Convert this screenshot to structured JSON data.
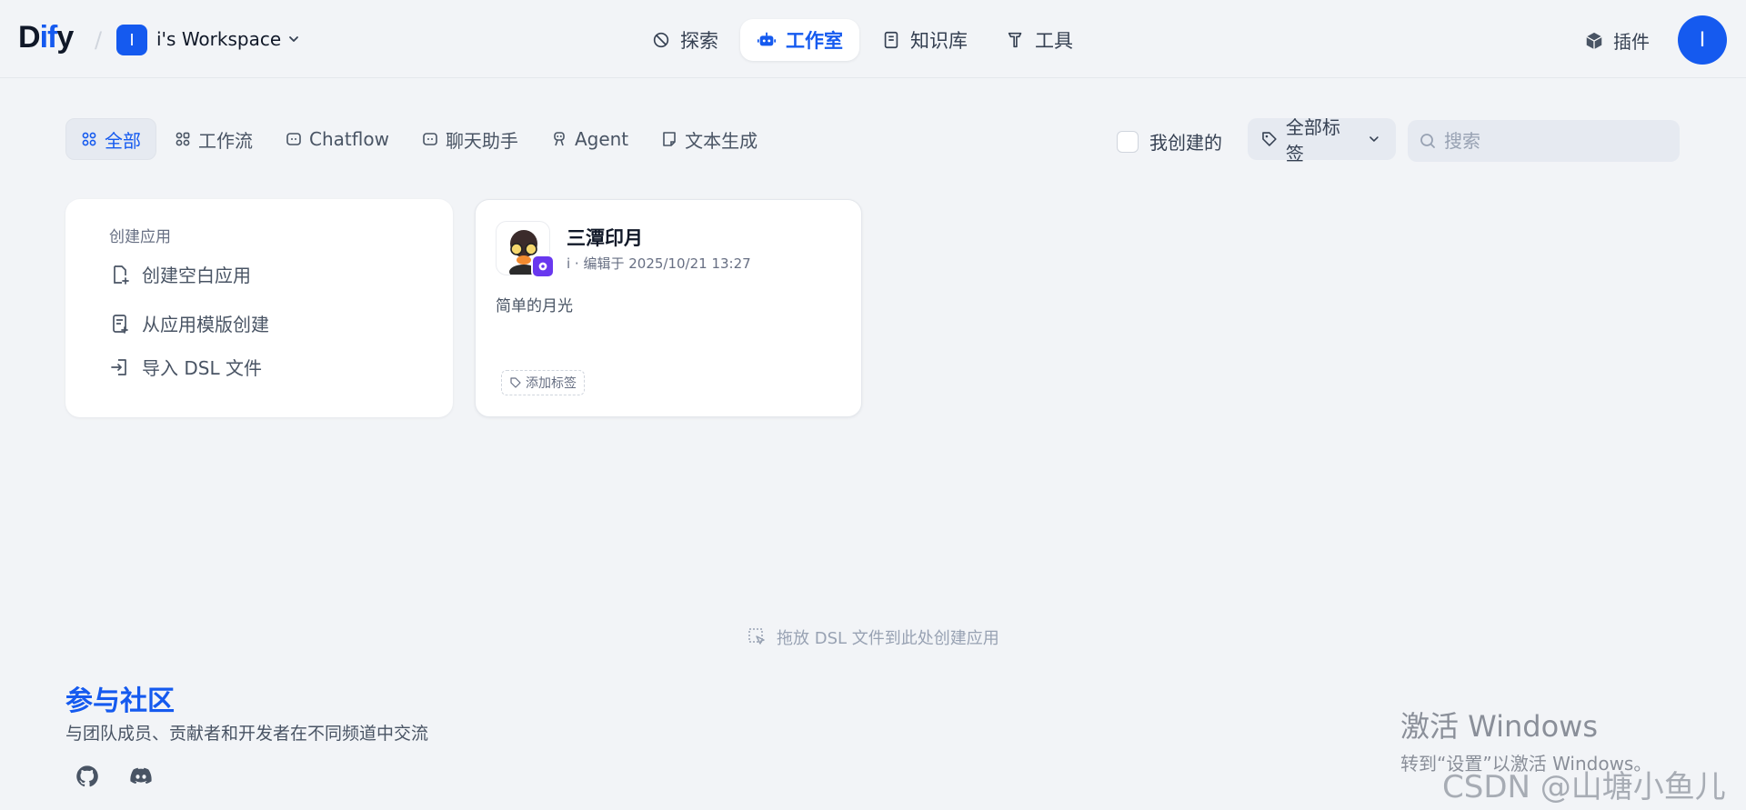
{
  "header": {
    "logo_part1": "D",
    "logo_part2": "if",
    "logo_part3": "y",
    "workspace_initial": "I",
    "workspace_name": "i's Workspace",
    "nav": [
      {
        "label": "探索",
        "icon": "explore-icon"
      },
      {
        "label": "工作室",
        "icon": "robot-icon",
        "active": true
      },
      {
        "label": "知识库",
        "icon": "book-icon"
      },
      {
        "label": "工具",
        "icon": "hammer-icon"
      }
    ],
    "plugins_label": "插件",
    "user_initial": "I"
  },
  "filters": {
    "tabs": [
      {
        "label": "全部",
        "icon": "grid-icon",
        "active": true
      },
      {
        "label": "工作流",
        "icon": "workflow-icon"
      },
      {
        "label": "Chatflow",
        "icon": "chatflow-icon"
      },
      {
        "label": "聊天助手",
        "icon": "chat-bot-icon"
      },
      {
        "label": "Agent",
        "icon": "agent-icon"
      },
      {
        "label": "文本生成",
        "icon": "document-icon"
      }
    ],
    "mine_label": "我创建的",
    "mine_checked": false,
    "tags_label": "全部标签",
    "search_placeholder": "搜索"
  },
  "create_card": {
    "title": "创建应用",
    "items": [
      {
        "label": "创建空白应用",
        "icon": "new-file-icon"
      },
      {
        "label": "从应用模版创建",
        "icon": "template-icon"
      },
      {
        "label": "导入 DSL 文件",
        "icon": "import-icon"
      }
    ]
  },
  "apps": [
    {
      "name": "三潭印月",
      "meta": "i · 编辑于 2025/10/21 13:27",
      "description": "简单的月光",
      "add_tag_label": "添加标签"
    }
  ],
  "drop_hint": "拖放 DSL 文件到此处创建应用",
  "community": {
    "title": "参与社区",
    "subtitle": "与团队成员、贡献者和开发者在不同频道中交流"
  },
  "watermark": {
    "line1": "激活 Windows",
    "line2": "转到“设置”以激活 Windows。",
    "csdn": "CSDN @山塘小鱼儿"
  },
  "colors": {
    "accent": "#155aef",
    "background": "#f2f4f7",
    "badge": "#6938ef"
  }
}
